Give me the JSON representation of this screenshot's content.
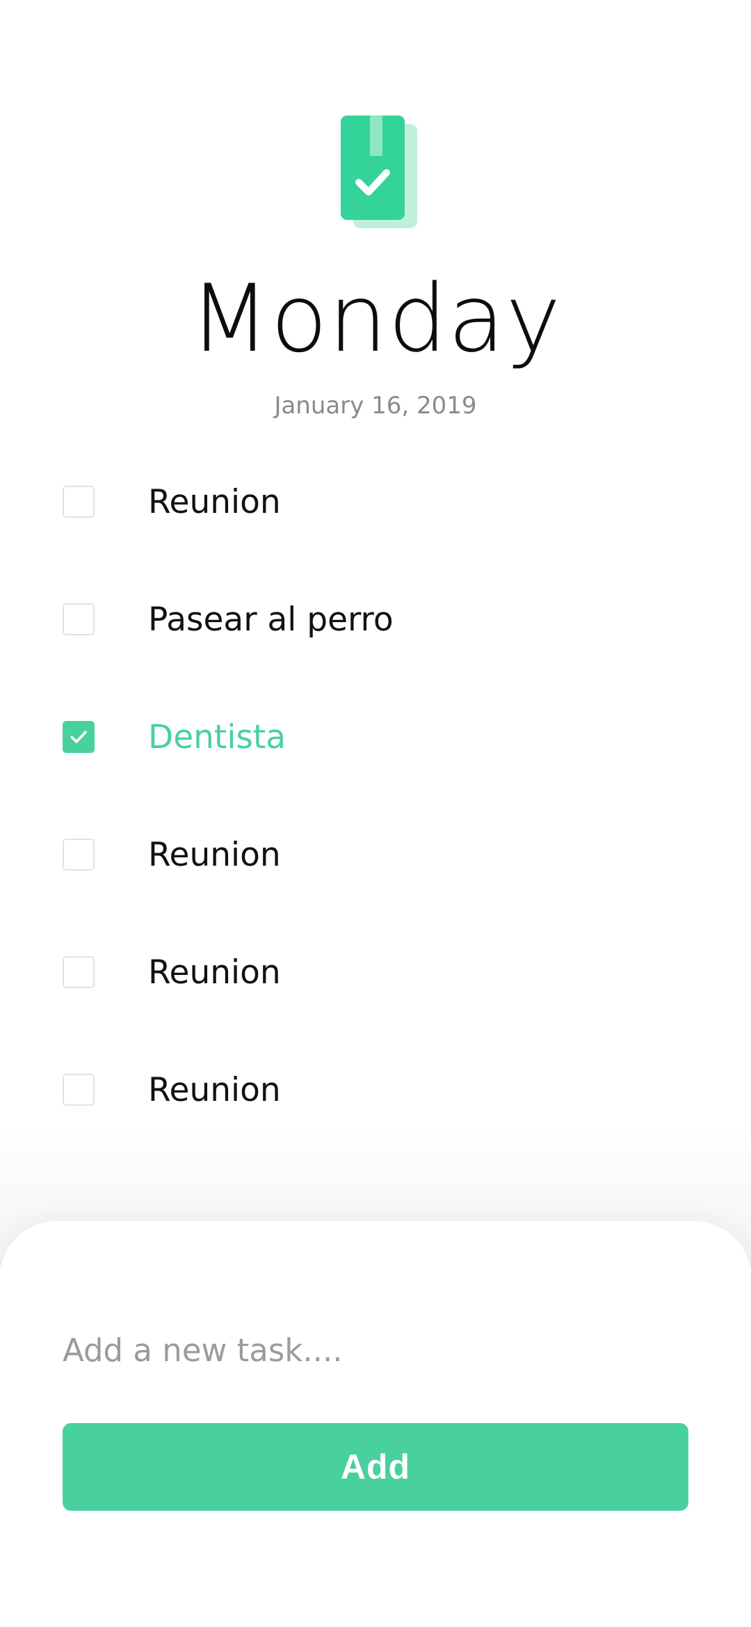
{
  "header": {
    "logo_icon": "checked-bookmark-icon",
    "title": "Monday",
    "date": "January 16, 2019"
  },
  "tasks": [
    {
      "label": "Reunion",
      "done": false
    },
    {
      "label": "Pasear al perro",
      "done": false
    },
    {
      "label": "Dentista",
      "done": true
    },
    {
      "label": "Reunion",
      "done": false
    },
    {
      "label": "Reunion",
      "done": false
    },
    {
      "label": "Reunion",
      "done": false
    }
  ],
  "composer": {
    "placeholder": "Add a new task....",
    "value": "",
    "add_label": "Add"
  },
  "colors": {
    "accent": "#48d19f",
    "logo": "#33d39a",
    "logo_back": "#bff0dc",
    "text": "#111111",
    "muted": "#8a8a8a"
  }
}
